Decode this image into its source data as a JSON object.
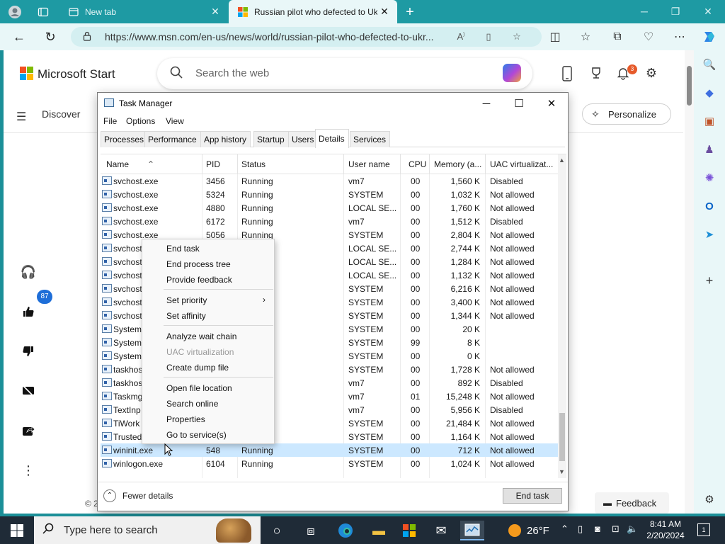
{
  "browser": {
    "tabs": [
      {
        "label": "New tab",
        "active": false
      },
      {
        "label": "Russian pilot who defected to Uk",
        "active": true
      }
    ],
    "url": "https://www.msn.com/en-us/news/world/russian-pilot-who-defected-to-ukr..."
  },
  "msn": {
    "brand": "Microsoft Start",
    "search_placeholder": "Search the web",
    "notif_count": "3",
    "nav_discover": "Discover",
    "personalize": "Personalize",
    "like_count": "87",
    "feedback": "Feedback",
    "copyright": "© 2"
  },
  "taskmanager": {
    "title": "Task Manager",
    "menu": [
      "File",
      "Options",
      "View"
    ],
    "tabs": [
      "Processes",
      "Performance",
      "App history",
      "Startup",
      "Users",
      "Details",
      "Services"
    ],
    "active_tab": "Details",
    "columns": [
      "Name",
      "PID",
      "Status",
      "User name",
      "CPU",
      "Memory (a...",
      "UAC virtualizat..."
    ],
    "rows": [
      {
        "name": "svchost.exe",
        "pid": "3456",
        "status": "Running",
        "user": "vm7",
        "cpu": "00",
        "mem": "1,560 K",
        "uac": "Disabled"
      },
      {
        "name": "svchost.exe",
        "pid": "5324",
        "status": "Running",
        "user": "SYSTEM",
        "cpu": "00",
        "mem": "1,032 K",
        "uac": "Not allowed"
      },
      {
        "name": "svchost.exe",
        "pid": "4880",
        "status": "Running",
        "user": "LOCAL SE...",
        "cpu": "00",
        "mem": "1,760 K",
        "uac": "Not allowed"
      },
      {
        "name": "svchost.exe",
        "pid": "6172",
        "status": "Running",
        "user": "vm7",
        "cpu": "00",
        "mem": "1,512 K",
        "uac": "Disabled"
      },
      {
        "name": "svchost.exe",
        "pid": "5056",
        "status": "Running",
        "user": "SYSTEM",
        "cpu": "00",
        "mem": "2,804 K",
        "uac": "Not allowed"
      },
      {
        "name": "svchost",
        "pid": "",
        "status": "",
        "user": "LOCAL SE...",
        "cpu": "00",
        "mem": "2,744 K",
        "uac": "Not allowed"
      },
      {
        "name": "svchost",
        "pid": "",
        "status": "",
        "user": "LOCAL SE...",
        "cpu": "00",
        "mem": "1,284 K",
        "uac": "Not allowed"
      },
      {
        "name": "svchost",
        "pid": "",
        "status": "",
        "user": "LOCAL SE...",
        "cpu": "00",
        "mem": "1,132 K",
        "uac": "Not allowed"
      },
      {
        "name": "svchost",
        "pid": "",
        "status": "",
        "user": "SYSTEM",
        "cpu": "00",
        "mem": "6,216 K",
        "uac": "Not allowed"
      },
      {
        "name": "svchost",
        "pid": "",
        "status": "",
        "user": "SYSTEM",
        "cpu": "00",
        "mem": "3,400 K",
        "uac": "Not allowed"
      },
      {
        "name": "svchost",
        "pid": "",
        "status": "",
        "user": "SYSTEM",
        "cpu": "00",
        "mem": "1,344 K",
        "uac": "Not allowed"
      },
      {
        "name": "System",
        "pid": "",
        "status": "",
        "user": "SYSTEM",
        "cpu": "00",
        "mem": "20 K",
        "uac": ""
      },
      {
        "name": "System",
        "pid": "",
        "status": "",
        "user": "SYSTEM",
        "cpu": "99",
        "mem": "8 K",
        "uac": ""
      },
      {
        "name": "System",
        "pid": "",
        "status": "",
        "user": "SYSTEM",
        "cpu": "00",
        "mem": "0 K",
        "uac": ""
      },
      {
        "name": "taskhos",
        "pid": "",
        "status": "",
        "user": "SYSTEM",
        "cpu": "00",
        "mem": "1,728 K",
        "uac": "Not allowed"
      },
      {
        "name": "taskhos",
        "pid": "",
        "status": "",
        "user": "vm7",
        "cpu": "00",
        "mem": "892 K",
        "uac": "Disabled"
      },
      {
        "name": "Taskmg",
        "pid": "",
        "status": "",
        "user": "vm7",
        "cpu": "01",
        "mem": "15,248 K",
        "uac": "Not allowed"
      },
      {
        "name": "TextInp",
        "pid": "",
        "status": "",
        "user": "vm7",
        "cpu": "00",
        "mem": "5,956 K",
        "uac": "Disabled"
      },
      {
        "name": "TiWork",
        "pid": "",
        "status": "",
        "user": "SYSTEM",
        "cpu": "00",
        "mem": "21,484 K",
        "uac": "Not allowed"
      },
      {
        "name": "Trusted",
        "pid": "",
        "status": "",
        "user": "SYSTEM",
        "cpu": "00",
        "mem": "1,164 K",
        "uac": "Not allowed"
      },
      {
        "name": "wininit.exe",
        "pid": "548",
        "status": "Running",
        "user": "SYSTEM",
        "cpu": "00",
        "mem": "712 K",
        "uac": "Not allowed",
        "selected": true
      },
      {
        "name": "winlogon.exe",
        "pid": "6104",
        "status": "Running",
        "user": "SYSTEM",
        "cpu": "00",
        "mem": "1,024 K",
        "uac": "Not allowed"
      }
    ],
    "fewer_details": "Fewer details",
    "end_task": "End task"
  },
  "context_menu": {
    "items": [
      {
        "label": "End task"
      },
      {
        "label": "End process tree"
      },
      {
        "label": "Provide feedback"
      },
      {
        "label": "Set priority",
        "submenu": true
      },
      {
        "label": "Set affinity"
      },
      {
        "label": "Analyze wait chain"
      },
      {
        "label": "UAC virtualization",
        "disabled": true
      },
      {
        "label": "Create dump file"
      },
      {
        "label": "Open file location"
      },
      {
        "label": "Search online"
      },
      {
        "label": "Properties"
      },
      {
        "label": "Go to service(s)"
      }
    ]
  },
  "taskbar": {
    "search_placeholder": "Type here to search",
    "temperature": "26°F",
    "time": "8:41 AM",
    "date": "2/20/2024",
    "notif_count": "1"
  },
  "colors": {
    "browser_frame": "#1e9aa3",
    "selection": "#cce8ff",
    "taskbar": "#1f2b37"
  }
}
